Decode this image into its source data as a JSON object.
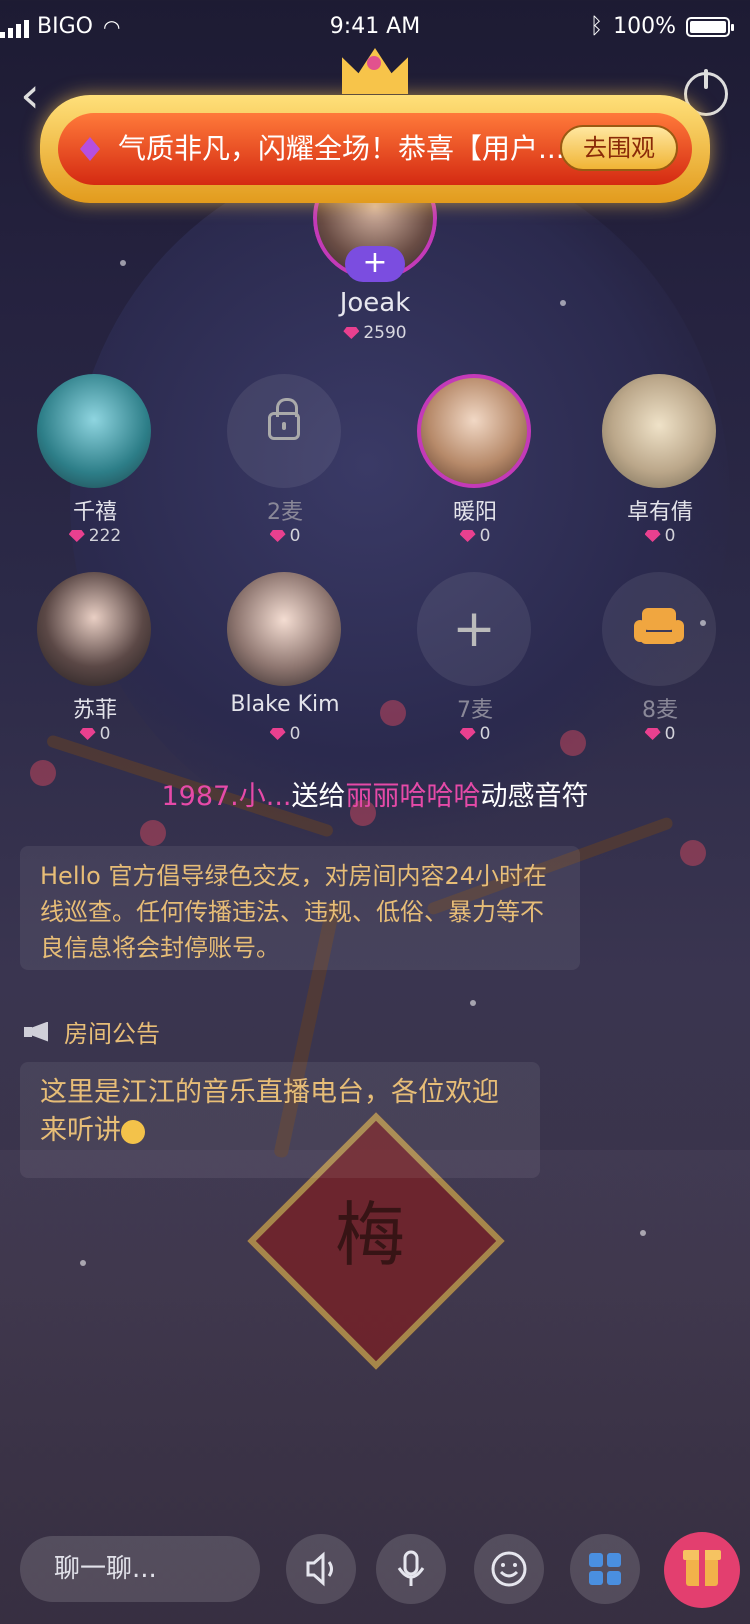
{
  "status_bar": {
    "carrier": "BIGO",
    "time": "9:41 AM",
    "battery": "100%"
  },
  "banner": {
    "text": "气质非凡，闪耀全场！恭喜【用户...",
    "button": "去围观"
  },
  "host": {
    "name": "Joeak",
    "score": "2590"
  },
  "seats": [
    {
      "name": "千禧",
      "score": "222",
      "state": "occupied"
    },
    {
      "name": "2麦",
      "score": "0",
      "state": "locked"
    },
    {
      "name": "暖阳",
      "score": "0",
      "state": "occupied"
    },
    {
      "name": "卓有倩",
      "score": "0",
      "state": "occupied"
    },
    {
      "name": "苏菲",
      "score": "0",
      "state": "occupied"
    },
    {
      "name": "Blake Kim",
      "score": "0",
      "state": "occupied"
    },
    {
      "name": "7麦",
      "score": "0",
      "state": "empty"
    },
    {
      "name": "8麦",
      "score": "0",
      "state": "sofa"
    }
  ],
  "gift_message": {
    "sender": "1987.小...",
    "action": "送给",
    "receiver": "丽丽哈哈哈",
    "gift": "动感音符"
  },
  "rules_text": "Hello 官方倡导绿色交友，对房间内容24小时在线巡查。任何传播违法、违规、低俗、暴力等不良信息将会封停账号。",
  "notice": {
    "title": "房间公告",
    "text": "这里是江江的音乐直播电台，各位欢迎来听讲"
  },
  "bottom_bar": {
    "chat_placeholder": "聊一聊..."
  },
  "colors": {
    "accent_pink": "#e64aa8",
    "notice_gold": "#e7bd77",
    "gift_button": "#e33f6f"
  }
}
